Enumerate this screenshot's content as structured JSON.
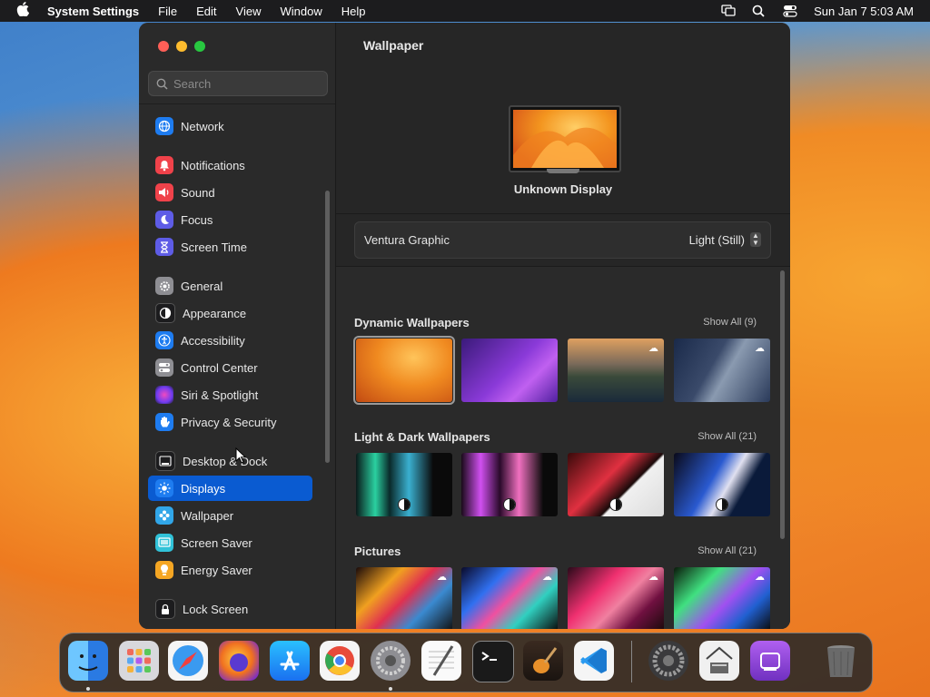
{
  "menubar": {
    "app_name": "System Settings",
    "menus": [
      "File",
      "Edit",
      "View",
      "Window",
      "Help"
    ],
    "datetime": "Sun Jan 7  5:03 AM"
  },
  "sidebar": {
    "search_placeholder": "Search",
    "items": [
      {
        "label": "Network",
        "icon": "globe-icon",
        "color": "#1e7cf0"
      },
      {
        "label": "Notifications",
        "icon": "bell-icon",
        "color": "#f0424a"
      },
      {
        "label": "Sound",
        "icon": "speaker-icon",
        "color": "#f0424a"
      },
      {
        "label": "Focus",
        "icon": "moon-icon",
        "color": "#5e5ce6"
      },
      {
        "label": "Screen Time",
        "icon": "hourglass-icon",
        "color": "#5e5ce6"
      },
      {
        "label": "General",
        "icon": "gear-icon",
        "color": "#8e8e93"
      },
      {
        "label": "Appearance",
        "icon": "appearance-icon",
        "color": "#1c1c1e"
      },
      {
        "label": "Accessibility",
        "icon": "accessibility-icon",
        "color": "#1e7cf0"
      },
      {
        "label": "Control Center",
        "icon": "toggles-icon",
        "color": "#8e8e93"
      },
      {
        "label": "Siri & Spotlight",
        "icon": "siri-icon",
        "color": "#b83cf0"
      },
      {
        "label": "Privacy & Security",
        "icon": "hand-icon",
        "color": "#1e7cf0"
      },
      {
        "label": "Desktop & Dock",
        "icon": "dock-icon",
        "color": "#1c1c1e"
      },
      {
        "label": "Displays",
        "icon": "sun-icon",
        "color": "#1e7cf0",
        "active": true
      },
      {
        "label": "Wallpaper",
        "icon": "flower-icon",
        "color": "#31a6e8"
      },
      {
        "label": "Screen Saver",
        "icon": "screensaver-icon",
        "color": "#31c2d8"
      },
      {
        "label": "Energy Saver",
        "icon": "bulb-icon",
        "color": "#f5a623"
      },
      {
        "label": "Lock Screen",
        "icon": "lock-icon",
        "color": "#1c1c1e"
      }
    ]
  },
  "main": {
    "title": "Wallpaper",
    "display_name": "Unknown Display",
    "current_wallpaper": "Ventura Graphic",
    "appearance_mode": "Light (Still)",
    "sections": [
      {
        "title": "Dynamic Wallpapers",
        "show_all": "Show All (9)"
      },
      {
        "title": "Light & Dark Wallpapers",
        "show_all": "Show All (21)"
      },
      {
        "title": "Pictures",
        "show_all": "Show All (21)"
      }
    ]
  },
  "dock": {
    "apps": [
      "Finder",
      "Launchpad",
      "Safari",
      "Firefox",
      "App Store",
      "Chrome",
      "System Settings",
      "TextEdit",
      "Terminal",
      "GarageBand",
      "Visual Studio Code",
      "System Preferences",
      "Archive Utility",
      "Podcasts",
      "Trash"
    ]
  }
}
